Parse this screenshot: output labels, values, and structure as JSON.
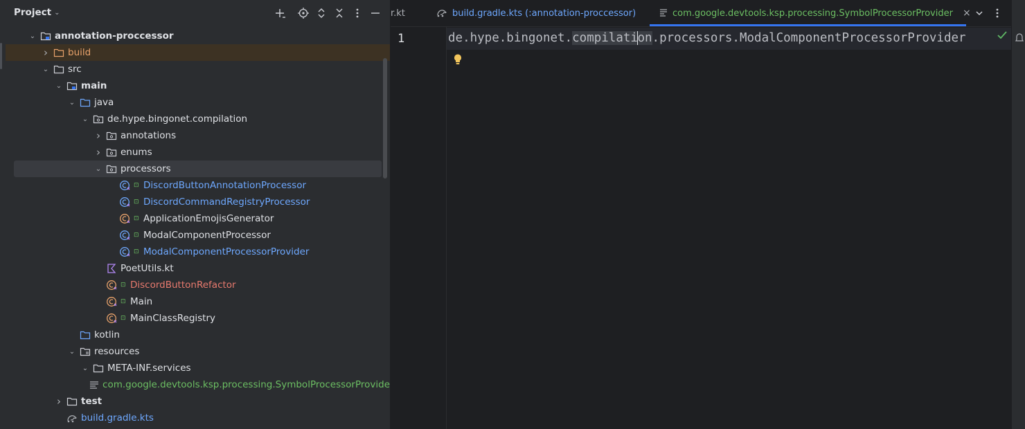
{
  "project_panel": {
    "title": "Project",
    "tree": [
      {
        "label": "annotation-proccessor",
        "depth": 0,
        "expanded": true,
        "icon": "module-folder-icon",
        "style": "default",
        "bold": true
      },
      {
        "label": "build",
        "depth": 1,
        "expanded": false,
        "icon": "excluded-folder-icon",
        "style": "orange"
      },
      {
        "label": "src",
        "depth": 1,
        "expanded": true,
        "icon": "folder-icon",
        "style": "default"
      },
      {
        "label": "main",
        "depth": 2,
        "expanded": true,
        "icon": "source-root-folder-icon",
        "style": "default",
        "bold": true
      },
      {
        "label": "java",
        "depth": 3,
        "expanded": true,
        "icon": "source-folder-icon",
        "style": "default"
      },
      {
        "label": "de.hype.bingonet.compilation",
        "depth": 4,
        "expanded": true,
        "icon": "package-icon",
        "style": "default"
      },
      {
        "label": "annotations",
        "depth": 5,
        "expanded": false,
        "icon": "package-icon",
        "style": "default"
      },
      {
        "label": "enums",
        "depth": 5,
        "expanded": false,
        "icon": "package-icon",
        "style": "default"
      },
      {
        "label": "processors",
        "depth": 5,
        "expanded": true,
        "icon": "package-icon",
        "style": "default",
        "selected": true
      },
      {
        "label": "DiscordButtonAnnotationProcessor",
        "depth": 6,
        "icon": "kotlin-class-icon",
        "style": "blue"
      },
      {
        "label": "DiscordCommandRegistryProcessor",
        "depth": 6,
        "icon": "kotlin-class-icon",
        "style": "blue"
      },
      {
        "label": "ApplicationEmojisGenerator",
        "depth": 6,
        "icon": "kotlin-object-icon",
        "style": "default"
      },
      {
        "label": "ModalComponentProcessor",
        "depth": 6,
        "icon": "kotlin-class-icon",
        "style": "default"
      },
      {
        "label": "ModalComponentProcessorProvider",
        "depth": 6,
        "icon": "kotlin-class-icon",
        "style": "blue"
      },
      {
        "label": "PoetUtils.kt",
        "depth": 5,
        "icon": "kotlin-file-icon",
        "style": "default"
      },
      {
        "label": "DiscordButtonRefactor",
        "depth": 5,
        "icon": "kotlin-object-icon",
        "style": "red"
      },
      {
        "label": "Main",
        "depth": 5,
        "icon": "kotlin-object-icon",
        "style": "default"
      },
      {
        "label": "MainClassRegistry",
        "depth": 5,
        "icon": "kotlin-object-icon",
        "style": "default"
      },
      {
        "label": "kotlin",
        "depth": 3,
        "icon": "source-folder-icon",
        "style": "default"
      },
      {
        "label": "resources",
        "depth": 3,
        "expanded": true,
        "icon": "resources-folder-icon",
        "style": "default"
      },
      {
        "label": "META-INF.services",
        "depth": 4,
        "expanded": true,
        "icon": "folder-icon",
        "style": "default"
      },
      {
        "label": "com.google.devtools.ksp.processing.SymbolProcessorProvide",
        "depth": 5,
        "icon": "text-file-icon",
        "style": "green"
      },
      {
        "label": "test",
        "depth": 2,
        "expanded": false,
        "icon": "folder-icon",
        "style": "default",
        "bold": true
      },
      {
        "label": "build.gradle.kts",
        "depth": 2,
        "icon": "gradle-icon",
        "style": "blue"
      }
    ]
  },
  "editor": {
    "tabs": [
      {
        "label": "r.kt",
        "icon": "",
        "style": "default"
      },
      {
        "label": "build.gradle.kts (:annotation-proccessor)",
        "icon": "gradle-icon",
        "style": "blue"
      },
      {
        "label": "com.google.devtools.ksp.processing.SymbolProcessorProvider",
        "icon": "text-file-icon",
        "style": "green",
        "active": true
      }
    ],
    "line_number": "1",
    "code": {
      "before": "de.hype.bingonet.",
      "word_a": "compilati",
      "word_b": "on",
      "after": ".processors.ModalComponentProcessorProvider"
    }
  },
  "colors": {
    "accent": "#3574f0",
    "blue_text": "#6ea8fe",
    "green_text": "#6cbf63",
    "orange_text": "#e8a26b",
    "red_text": "#e87a6e"
  }
}
